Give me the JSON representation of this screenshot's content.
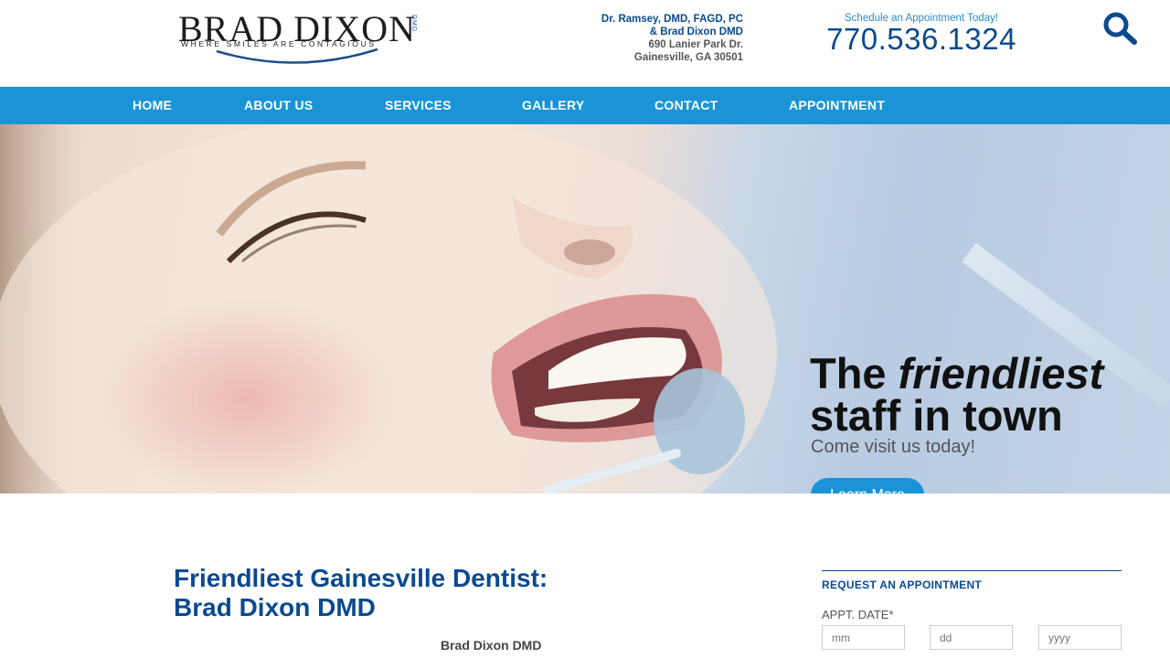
{
  "logo": {
    "name": "BRAD DIXON",
    "tagline": "Where Smiles Are Contagious",
    "suffix": "DMD"
  },
  "address": {
    "line1": "Dr. Ramsey, DMD, FAGD, PC",
    "line2": "& Brad Dixon DMD",
    "line3": "690 Lanier Park Dr.",
    "line4": "Gainesville, GA 30501"
  },
  "phone": {
    "tagline": "Schedule an Appointment Today!",
    "number": "770.536.1324"
  },
  "search": {
    "icon": "search-icon"
  },
  "nav": {
    "items": [
      {
        "label": "HOME"
      },
      {
        "label": "ABOUT US"
      },
      {
        "label": "SERVICES"
      },
      {
        "label": "GALLERY"
      },
      {
        "label": "CONTACT"
      },
      {
        "label": "APPOINTMENT"
      }
    ]
  },
  "hero": {
    "title_pre": "The ",
    "title_em": "friendliest",
    "title_line2": "staff in town",
    "subtitle": "Come visit us today!",
    "button": "Learn More"
  },
  "content": {
    "title_line1": "Friendliest Gainesville Dentist:",
    "title_line2": "Brad Dixon DMD",
    "subtitle": "Brad Dixon DMD"
  },
  "appointment": {
    "title": "REQUEST AN APPOINTMENT",
    "date_label": "APPT. DATE*",
    "mm_placeholder": "mm",
    "dd_placeholder": "dd",
    "yyyy_placeholder": "yyyy"
  },
  "colors": {
    "brand_blue": "#0b4a8f",
    "nav_blue": "#1a94d6",
    "accent_light": "#2a8ccf"
  }
}
